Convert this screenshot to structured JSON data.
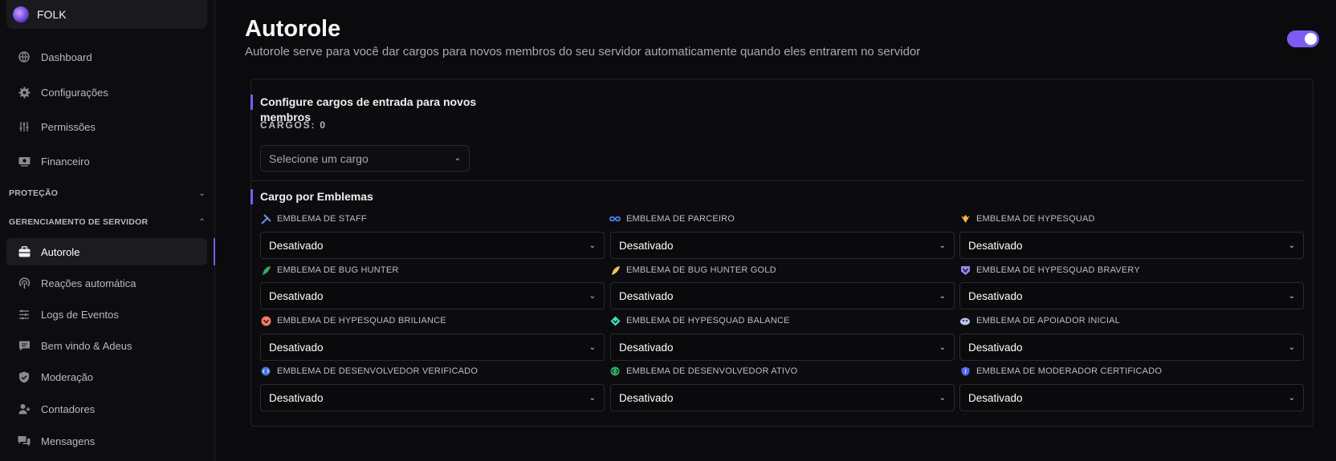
{
  "server": {
    "name": "FOLK"
  },
  "nav": {
    "top_items": [
      {
        "label": "Dashboard",
        "icon": "globe-icon"
      },
      {
        "label": "Configurações",
        "icon": "gear-icon"
      },
      {
        "label": "Permissões",
        "icon": "sliders-icon"
      },
      {
        "label": "Financeiro",
        "icon": "money-icon"
      }
    ],
    "section_protecao": "PROTEÇÃO",
    "section_gerenciamento": "GERENCIAMENTO DE SERVIDOR",
    "server_items": [
      {
        "label": "Autorole",
        "icon": "briefcase-icon",
        "active": true
      },
      {
        "label": "Reações automática",
        "icon": "reaction-icon"
      },
      {
        "label": "Logs de Eventos",
        "icon": "list-icon"
      },
      {
        "label": "Bem vindo & Adeus",
        "icon": "chat-icon"
      },
      {
        "label": "Moderação",
        "icon": "shield-check-icon"
      },
      {
        "label": "Contadores",
        "icon": "user-plus-icon"
      },
      {
        "label": "Mensagens",
        "icon": "messages-icon"
      }
    ]
  },
  "page": {
    "title": "Autorole",
    "subtitle": "Autorole serve para você dar cargos para novos membros do seu servidor automaticamente quando eles entrarem no servidor",
    "enabled": true
  },
  "entry_roles": {
    "heading": "Configure cargos de entrada para novos membros",
    "count_label": "CARGOS: 0",
    "select_placeholder": "Selecione um cargo"
  },
  "badges": {
    "heading": "Cargo por Emblemas",
    "items": [
      {
        "label": "EMBLEMA DE STAFF",
        "value": "Desativado",
        "icon": "staff-tools-icon",
        "color": "#5865f2"
      },
      {
        "label": "EMBLEMA DE PARCEIRO",
        "value": "Desativado",
        "icon": "infinity-icon",
        "color": "#4e7ff0"
      },
      {
        "label": "EMBLEMA DE HYPESQUAD",
        "value": "Desativado",
        "icon": "hypesquad-icon",
        "color": "#f7b73a"
      },
      {
        "label": "EMBLEMA DE BUG HUNTER",
        "value": "Desativado",
        "icon": "bug-hunter-icon",
        "color": "#3ba55d"
      },
      {
        "label": "EMBLEMA DE BUG HUNTER GOLD",
        "value": "Desativado",
        "icon": "bug-hunter-gold-icon",
        "color": "#f5c451"
      },
      {
        "label": "EMBLEMA DE HYPESQUAD BRAVERY",
        "value": "Desativado",
        "icon": "bravery-icon",
        "color": "#9c84ef"
      },
      {
        "label": "EMBLEMA DE HYPESQUAD BRILIANCE",
        "value": "Desativado",
        "icon": "brilliance-icon",
        "color": "#f47b67"
      },
      {
        "label": "EMBLEMA DE HYPESQUAD BALANCE",
        "value": "Desativado",
        "icon": "balance-icon",
        "color": "#45ddc0"
      },
      {
        "label": "EMBLEMA DE APOIADOR INICIAL",
        "value": "Desativado",
        "icon": "early-supporter-icon",
        "color": "#b7c3f5"
      },
      {
        "label": "EMBLEMA DE DESENVOLVEDOR VERIFICADO",
        "value": "Desativado",
        "icon": "verified-dev-icon",
        "color": "#3e70dd"
      },
      {
        "label": "EMBLEMA DE DESENVOLVEDOR ATIVO",
        "value": "Desativado",
        "icon": "active-dev-icon",
        "color": "#2ea967"
      },
      {
        "label": "EMBLEMA DE MODERADOR CERTIFICADO",
        "value": "Desativado",
        "icon": "cert-mod-icon",
        "color": "#5865f2"
      }
    ]
  },
  "colors": {
    "accent": "#7c5cf5",
    "background": "#0b0b0d"
  }
}
